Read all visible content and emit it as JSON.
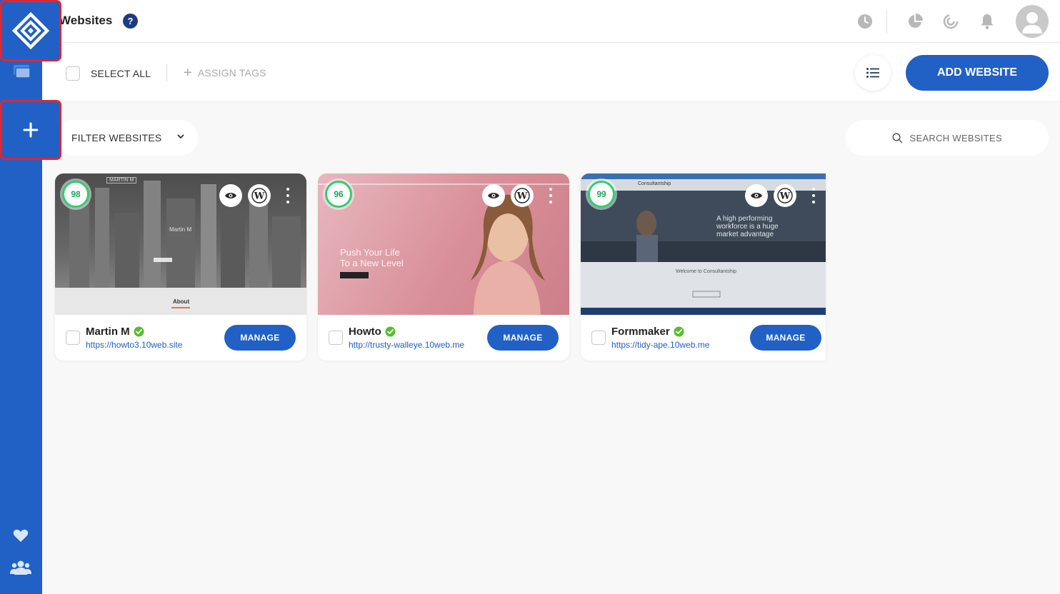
{
  "header": {
    "title": "Websites",
    "help": "?"
  },
  "toolbar": {
    "select_all": "SELECT ALL",
    "assign_tags": "ASSIGN TAGS",
    "add_website": "ADD WEBSITE"
  },
  "filter": {
    "label": "FILTER WEBSITES"
  },
  "search": {
    "placeholder": "SEARCH WEBSITES"
  },
  "sites": [
    {
      "name": "Martin M",
      "url": "https://howto3.10web.site",
      "score": "98",
      "manage": "MANAGE",
      "thumb": {
        "brand": "MARTIN M",
        "heading": "Martin M",
        "section": "About"
      }
    },
    {
      "name": "Howto",
      "url": "http://trusty-walleye.10web.me",
      "score": "96",
      "manage": "MANAGE",
      "thumb": {
        "line1": "Push Your Life",
        "line2": "To a New Level"
      }
    },
    {
      "name": "Formmaker",
      "url": "https://tidy-ape.10web.me",
      "score": "99",
      "manage": "MANAGE",
      "thumb": {
        "brand": "Consultantship",
        "line1": "A high performing",
        "line2": "workforce is a huge",
        "line3": "market advantage",
        "welcome": "Welcome to Consultantship"
      }
    }
  ],
  "colors": {
    "primary": "#2160c4",
    "highlight": "#e1252f",
    "score_ring": "#2dcf6f",
    "verified": "#54c02a"
  }
}
